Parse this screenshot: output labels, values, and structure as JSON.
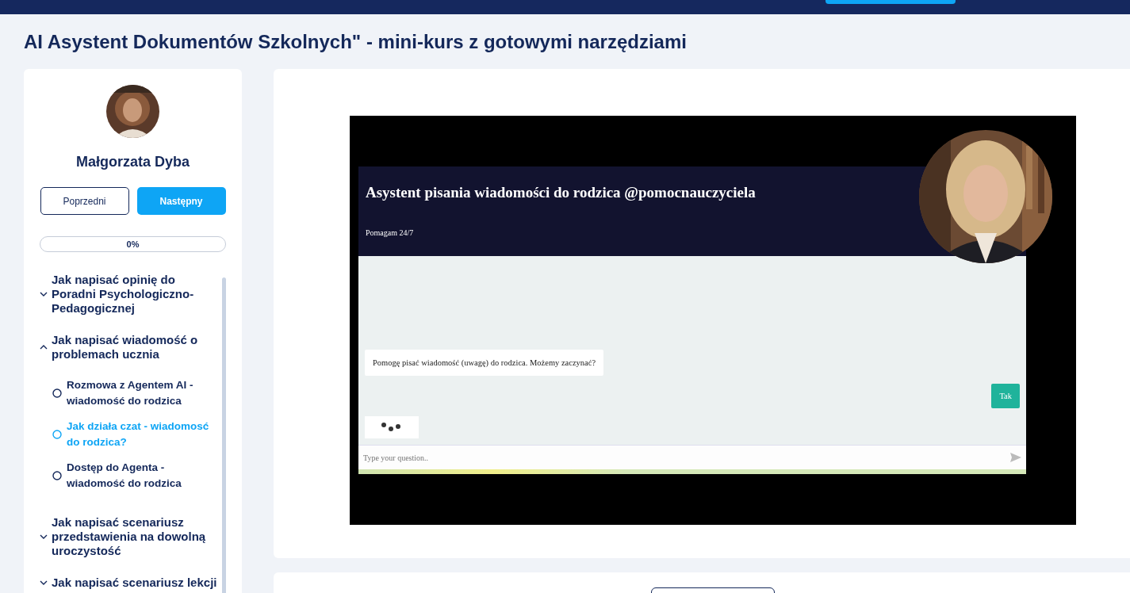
{
  "page_title": "AI Asystent Dokumentów Szkolnych\" - mini-kurs z gotowymi narzędziami",
  "instructor": {
    "name": "Małgorzata Dyba"
  },
  "nav_buttons": [
    {
      "label": "Poprzedni",
      "kind": "outline"
    },
    {
      "label": "Następny",
      "kind": "primary"
    }
  ],
  "progress": {
    "label": "0%",
    "level": 0
  },
  "modules": [
    {
      "title": "Jak napisać opinię do Poradni Psychologiczno-Pedagogicznej",
      "expanded": false
    },
    {
      "title": "Jak napisać wiadomość o problemach ucznia",
      "expanded": true,
      "children": [
        {
          "title": "Rozmowa z Agentem AI - wiadomość do rodzica",
          "selected": false
        },
        {
          "title": "Jak działa czat - wiadomosć do rodzica?",
          "selected": true
        },
        {
          "title": "Dostęp do Agenta - wiadomość do rodzica",
          "selected": false
        }
      ]
    },
    {
      "title": "Jak napisać scenariusz przedstawienia na dowolną uroczystość",
      "expanded": false
    },
    {
      "title": "Jak napisać scenariusz lekcji",
      "expanded": false
    }
  ],
  "video": {
    "chat": {
      "title": "Asystent pisania wiadomości do rodzica @pomocnauczyciela",
      "subtitle": "Pomagam 24/7",
      "messages": [
        {
          "kind": "bot",
          "text": "Pomogę pisać wiadomość (uwagę) do rodzica. Możemy zaczynać?"
        },
        {
          "kind": "user",
          "text": "Tak"
        },
        {
          "kind": "typing"
        }
      ],
      "input": {
        "placeholder": "Type your question.."
      }
    }
  }
}
